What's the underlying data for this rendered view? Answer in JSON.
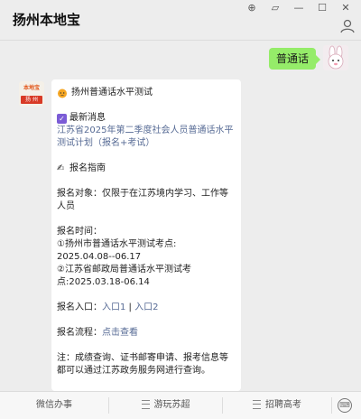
{
  "window": {
    "title": "扬州本地宝",
    "controls": [
      "⊕",
      "▱",
      "—",
      "☐",
      "✕"
    ]
  },
  "chat": {
    "my_message": "普通话",
    "card": {
      "title": "扬州普通话水平测试",
      "news_label": "最新消息",
      "news_link": "江苏省2025年第二季度社会人员普通话水平测试计划（报名+考试）",
      "guide_label": "报名指南",
      "target": "报名对象：仅限于在江苏境内学习、工作等人员",
      "time_label": "报名时间：",
      "time_1a": "①扬州市普通话水平测试考点:",
      "time_1b": "2025.04.08--06.17",
      "time_2a": "②江苏省邮政局普通话水平测试考",
      "time_2b": "点:2025.03.18-06.14",
      "entry_label": "报名入口：",
      "entry_1": "入口1",
      "entry_sep": " | ",
      "entry_2": "入口2",
      "flow_label": "报名流程：",
      "flow_link": "点击查看",
      "note": "注：成绩查询、证书邮寄申请、报考信息等都可以通过江苏政务服务网进行查询。"
    },
    "app_avatar_top": "本地宝",
    "app_avatar_bottom": "扬 州"
  },
  "bottom_tabs": [
    "微信办事",
    "游玩苏超",
    "招聘高考"
  ],
  "colors": {
    "bubble_green": "#95ec69",
    "link": "#576b95"
  }
}
